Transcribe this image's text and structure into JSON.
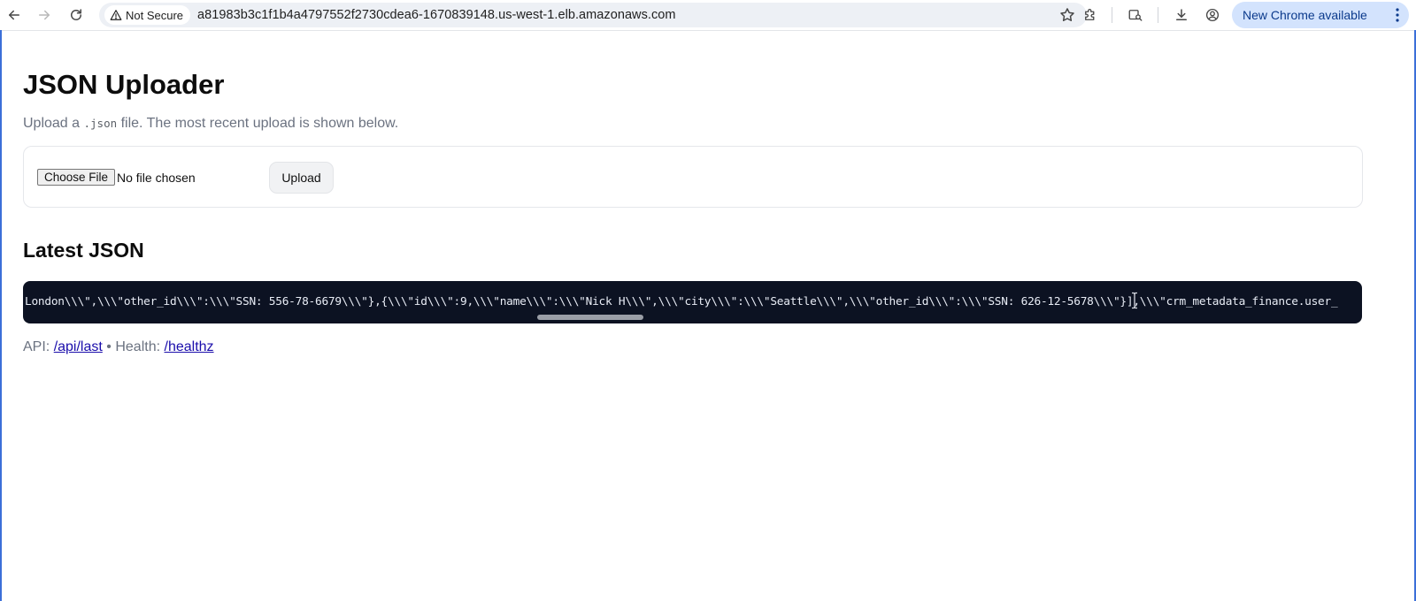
{
  "browser": {
    "security_label": "Not Secure",
    "url": "a81983b3c1f1b4a4797552f2730cdea6-1670839148.us-west-1.elb.amazonaws.com",
    "update_label": "New Chrome available"
  },
  "page": {
    "title": "JSON Uploader",
    "subtitle_before": "Upload a ",
    "subtitle_code": ".json",
    "subtitle_after": " file. The most recent upload is shown below.",
    "choose_file_label": "Choose File",
    "no_file_label": "No file chosen",
    "upload_label": "Upload",
    "latest_heading": "Latest JSON",
    "json_content": "London\\\\\\\",\\\\\\\"other_id\\\\\\\":\\\\\\\"SSN: 556-78-6679\\\\\\\"},{\\\\\\\"id\\\\\\\":9,\\\\\\\"name\\\\\\\":\\\\\\\"Nick H\\\\\\\",\\\\\\\"city\\\\\\\":\\\\\\\"Seattle\\\\\\\",\\\\\\\"other_id\\\\\\\":\\\\\\\"SSN: 626-12-5678\\\\\\\"}],\\\\\\\"crm_metadata_finance.user_",
    "api_label": "API:",
    "api_link": "/api/last",
    "bullet": "•",
    "health_label": "Health:",
    "health_link": "/healthz"
  }
}
